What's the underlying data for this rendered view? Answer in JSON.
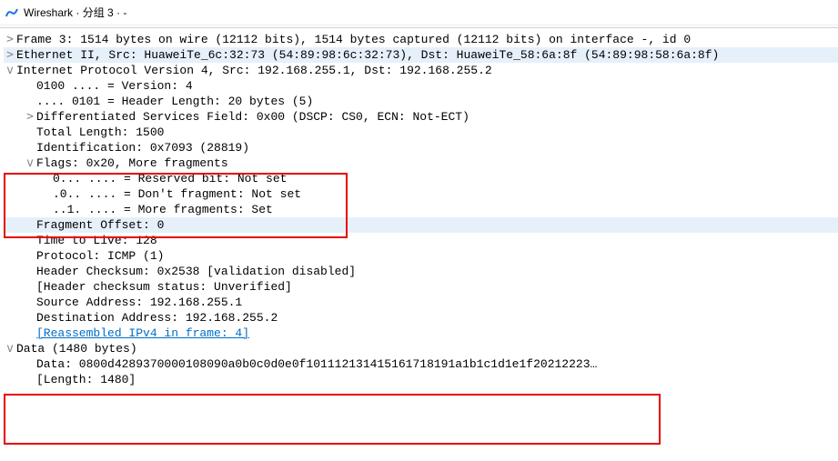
{
  "titlebar": {
    "app": "Wireshark",
    "doc": "分组 3",
    "suffix": "-"
  },
  "tree": {
    "frame": "Frame 3: 1514 bytes on wire (12112 bits), 1514 bytes captured (12112 bits) on interface -, id 0",
    "ethernet": "Ethernet II, Src: HuaweiTe_6c:32:73 (54:89:98:6c:32:73), Dst: HuaweiTe_58:6a:8f (54:89:98:58:6a:8f)",
    "ipv4": {
      "header": "Internet Protocol Version 4, Src: 192.168.255.1, Dst: 192.168.255.2",
      "version": "0100 .... = Version: 4",
      "hlen": ".... 0101 = Header Length: 20 bytes (5)",
      "dsf": "Differentiated Services Field: 0x00 (DSCP: CS0, ECN: Not-ECT)",
      "totlen": "Total Length: 1500",
      "ident": "Identification: 0x7093 (28819)",
      "flags": {
        "header": "Flags: 0x20, More fragments",
        "reserved": "0... .... = Reserved bit: Not set",
        "dontfrag": ".0.. .... = Don't fragment: Not set",
        "morefrag": "..1. .... = More fragments: Set"
      },
      "fragoffset": "Fragment Offset: 0",
      "ttl": "Time to Live: 128",
      "protocol": "Protocol: ICMP (1)",
      "hcsum": "Header Checksum: 0x2538 [validation disabled]",
      "hcsumstat": "[Header checksum status: Unverified]",
      "srcaddr": "Source Address: 192.168.255.1",
      "dstaddr": "Destination Address: 192.168.255.2",
      "reassembled": "[Reassembled IPv4 in frame: 4]"
    },
    "data": {
      "header": "Data (1480 bytes)",
      "bytes": "Data: 0800d4289370000108090a0b0c0d0e0f101112131415161718191a1b1c1d1e1f20212223…",
      "length": "[Length: 1480]"
    }
  },
  "icons": {
    "expand": ">",
    "collapse": "v",
    "sep": "·"
  }
}
